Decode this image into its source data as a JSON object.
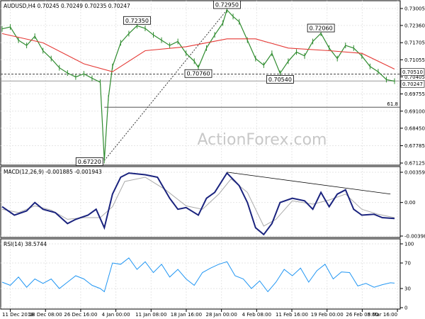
{
  "watermark": "ActionForex.com",
  "chart_data": [
    {
      "type": "line",
      "title": "AUDUSD,H4  0.70245 0.70249 0.70235 0.70247",
      "ylim": [
        0.67125,
        0.73005
      ],
      "y_ticks": [
        "0.73005",
        "0.72360",
        "0.71705",
        "0.71055",
        "0.70405",
        "0.69755",
        "0.69100",
        "0.68450",
        "0.67785",
        "0.67125"
      ],
      "x_ticks": [
        "11 Dec 2018",
        "18 Dec 08:00",
        "26 Dec 16:00",
        "4 Jan 00:00",
        "11 Jan 08:00",
        "18 Jan 16:00",
        "28 Jan 00:00",
        "4 Feb 08:00",
        "11 Feb 16:00",
        "19 Feb 00:00",
        "26 Feb 08:00",
        "5 Mar 16:00"
      ],
      "price_points": [
        [
          0,
          0.7223
        ],
        [
          4,
          0.723
        ],
        [
          8,
          0.718
        ],
        [
          12,
          0.716
        ],
        [
          16,
          0.7195
        ],
        [
          20,
          0.714
        ],
        [
          24,
          0.711
        ],
        [
          28,
          0.7075
        ],
        [
          32,
          0.7055
        ],
        [
          36,
          0.704
        ],
        [
          40,
          0.7052
        ],
        [
          44,
          0.7035
        ],
        [
          48,
          0.702
        ],
        [
          50,
          0.6722
        ],
        [
          52,
          0.696
        ],
        [
          54,
          0.708
        ],
        [
          58,
          0.717
        ],
        [
          62,
          0.7205
        ],
        [
          66,
          0.7235
        ],
        [
          70,
          0.7225
        ],
        [
          74,
          0.72
        ],
        [
          78,
          0.718
        ],
        [
          82,
          0.716
        ],
        [
          86,
          0.7175
        ],
        [
          90,
          0.713
        ],
        [
          94,
          0.71
        ],
        [
          96,
          0.7076
        ],
        [
          100,
          0.715
        ],
        [
          104,
          0.72
        ],
        [
          108,
          0.7245
        ],
        [
          110,
          0.7295
        ],
        [
          113,
          0.727
        ],
        [
          116,
          0.725
        ],
        [
          120,
          0.718
        ],
        [
          124,
          0.711
        ],
        [
          128,
          0.7085
        ],
        [
          132,
          0.713
        ],
        [
          136,
          0.7054
        ],
        [
          140,
          0.71
        ],
        [
          144,
          0.7135
        ],
        [
          148,
          0.712
        ],
        [
          152,
          0.7175
        ],
        [
          156,
          0.7206
        ],
        [
          160,
          0.715
        ],
        [
          164,
          0.711
        ],
        [
          168,
          0.716
        ],
        [
          172,
          0.715
        ],
        [
          176,
          0.712
        ],
        [
          180,
          0.708
        ],
        [
          184,
          0.706
        ],
        [
          188,
          0.703
        ],
        [
          192,
          0.7024
        ]
      ],
      "moving_average": [
        [
          0,
          0.7205
        ],
        [
          20,
          0.717
        ],
        [
          40,
          0.709
        ],
        [
          54,
          0.706
        ],
        [
          70,
          0.714
        ],
        [
          90,
          0.7155
        ],
        [
          110,
          0.7185
        ],
        [
          124,
          0.7185
        ],
        [
          140,
          0.715
        ],
        [
          160,
          0.714
        ],
        [
          176,
          0.713
        ],
        [
          192,
          0.707
        ]
      ],
      "callouts": [
        {
          "text": "0.72950",
          "x": 110,
          "y": 0.7295
        },
        {
          "text": "0.72350",
          "x": 66,
          "y": 0.7235
        },
        {
          "text": "0.70760",
          "x": 96,
          "y": 0.7076
        },
        {
          "text": "0.72060",
          "x": 156,
          "y": 0.7206
        },
        {
          "text": "0.70540",
          "x": 136,
          "y": 0.7054
        },
        {
          "text": "0.67220",
          "x": 50,
          "y": 0.6722
        }
      ],
      "price_labels": [
        "0.70510",
        "0.70247"
      ],
      "fib_label": "61.8"
    },
    {
      "type": "line",
      "title": "MACD(12,26,9) -0.001885 -0.001943",
      "ylim": [
        -0.003986,
        0.003592
      ],
      "y_ticks": [
        "0.003592",
        "0.00",
        "-0.003986"
      ],
      "macd": [
        [
          0,
          -0.0005
        ],
        [
          6,
          -0.0015
        ],
        [
          12,
          -0.001
        ],
        [
          16,
          0.0
        ],
        [
          20,
          -0.0008
        ],
        [
          26,
          -0.0012
        ],
        [
          32,
          -0.0025
        ],
        [
          36,
          -0.002
        ],
        [
          42,
          -0.0015
        ],
        [
          46,
          -0.0008
        ],
        [
          50,
          -0.003
        ],
        [
          54,
          0.001
        ],
        [
          58,
          0.003
        ],
        [
          62,
          0.0035
        ],
        [
          70,
          0.0033
        ],
        [
          76,
          0.003
        ],
        [
          82,
          0.0005
        ],
        [
          86,
          -0.0008
        ],
        [
          90,
          -0.0006
        ],
        [
          96,
          -0.0015
        ],
        [
          100,
          0.0005
        ],
        [
          104,
          0.0012
        ],
        [
          110,
          0.0035
        ],
        [
          116,
          0.002
        ],
        [
          120,
          0.0
        ],
        [
          124,
          -0.003
        ],
        [
          128,
          -0.0038
        ],
        [
          132,
          -0.0025
        ],
        [
          136,
          0.0
        ],
        [
          142,
          0.0005
        ],
        [
          148,
          0.0002
        ],
        [
          152,
          -0.0008
        ],
        [
          156,
          0.0012
        ],
        [
          160,
          -0.0005
        ],
        [
          164,
          0.001
        ],
        [
          168,
          0.0015
        ],
        [
          172,
          -0.0008
        ],
        [
          176,
          -0.0015
        ],
        [
          182,
          -0.0014
        ],
        [
          186,
          -0.0018
        ],
        [
          192,
          -0.0019
        ]
      ],
      "signal": [
        [
          0,
          -0.0008
        ],
        [
          8,
          -0.0012
        ],
        [
          16,
          -0.0004
        ],
        [
          24,
          -0.0009
        ],
        [
          32,
          -0.002
        ],
        [
          40,
          -0.0018
        ],
        [
          48,
          -0.0018
        ],
        [
          54,
          -0.0005
        ],
        [
          60,
          0.0025
        ],
        [
          70,
          0.003
        ],
        [
          80,
          0.0015
        ],
        [
          90,
          -0.0004
        ],
        [
          98,
          -0.0008
        ],
        [
          106,
          0.001
        ],
        [
          112,
          0.0028
        ],
        [
          120,
          0.0012
        ],
        [
          128,
          -0.0028
        ],
        [
          134,
          -0.002
        ],
        [
          142,
          0.0002
        ],
        [
          152,
          -0.0002
        ],
        [
          160,
          0.0003
        ],
        [
          168,
          0.001
        ],
        [
          176,
          -0.0008
        ],
        [
          184,
          -0.0014
        ],
        [
          192,
          -0.0018
        ]
      ]
    },
    {
      "type": "line",
      "title": "RSI(14) 38.5744",
      "ylim": [
        0,
        100
      ],
      "y_ticks": [
        "100",
        "70",
        "30",
        "0"
      ],
      "rsi": [
        [
          0,
          40
        ],
        [
          4,
          35
        ],
        [
          8,
          48
        ],
        [
          12,
          32
        ],
        [
          16,
          45
        ],
        [
          20,
          38
        ],
        [
          24,
          45
        ],
        [
          28,
          30
        ],
        [
          32,
          40
        ],
        [
          36,
          50
        ],
        [
          40,
          45
        ],
        [
          44,
          35
        ],
        [
          48,
          30
        ],
        [
          50,
          25
        ],
        [
          54,
          70
        ],
        [
          58,
          68
        ],
        [
          62,
          78
        ],
        [
          66,
          60
        ],
        [
          70,
          72
        ],
        [
          74,
          55
        ],
        [
          78,
          68
        ],
        [
          82,
          48
        ],
        [
          86,
          60
        ],
        [
          90,
          45
        ],
        [
          94,
          35
        ],
        [
          98,
          55
        ],
        [
          102,
          62
        ],
        [
          106,
          68
        ],
        [
          110,
          72
        ],
        [
          114,
          50
        ],
        [
          118,
          45
        ],
        [
          122,
          30
        ],
        [
          126,
          42
        ],
        [
          130,
          25
        ],
        [
          134,
          40
        ],
        [
          138,
          60
        ],
        [
          142,
          50
        ],
        [
          146,
          62
        ],
        [
          150,
          40
        ],
        [
          154,
          58
        ],
        [
          158,
          68
        ],
        [
          162,
          45
        ],
        [
          166,
          56
        ],
        [
          170,
          55
        ],
        [
          174,
          34
        ],
        [
          178,
          38
        ],
        [
          182,
          32
        ],
        [
          186,
          36
        ],
        [
          190,
          39
        ],
        [
          192,
          38.5
        ]
      ]
    }
  ]
}
